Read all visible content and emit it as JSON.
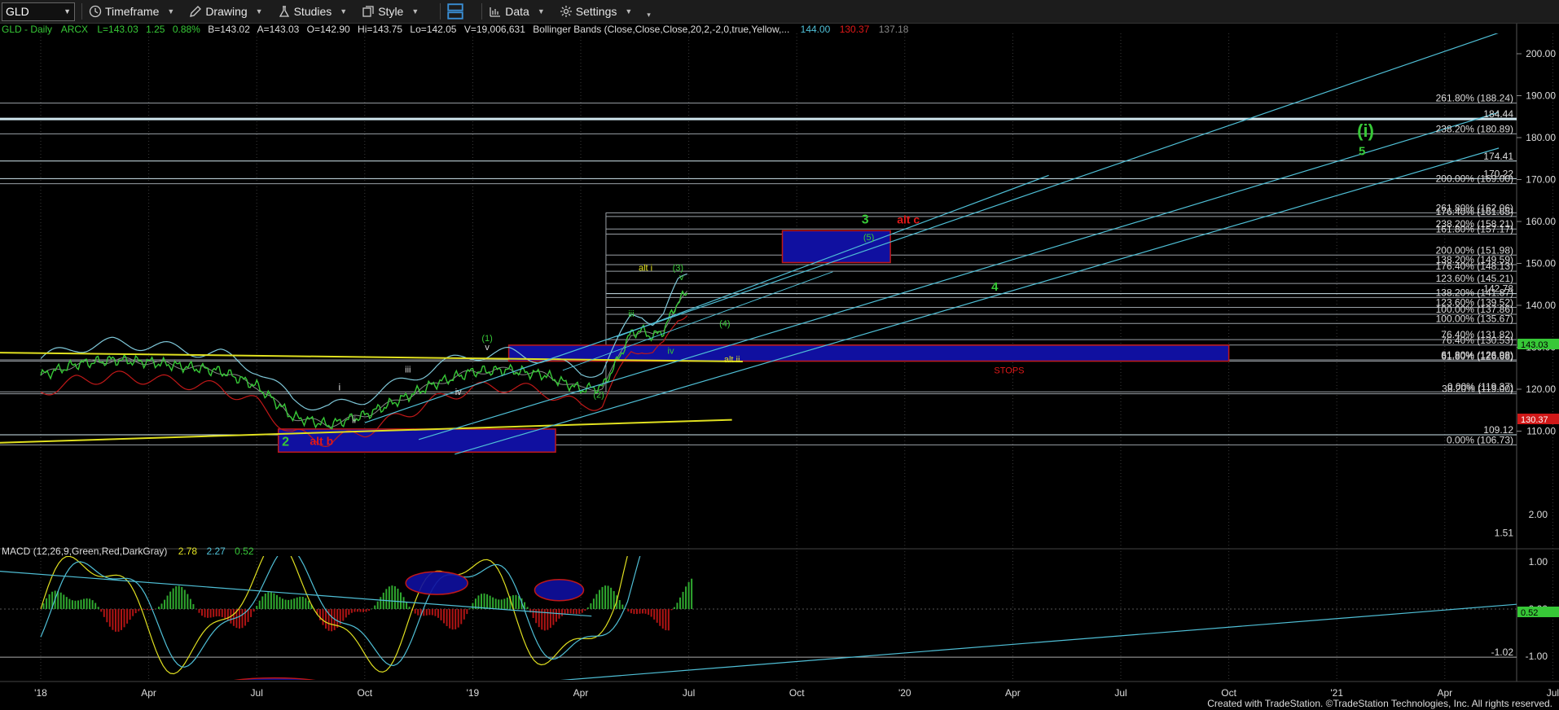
{
  "toolbar": {
    "symbol": "GLD",
    "buttons": [
      {
        "label": "Timeframe",
        "icon": "clock-icon"
      },
      {
        "label": "Drawing",
        "icon": "pencil-icon"
      },
      {
        "label": "Studies",
        "icon": "flask-icon"
      },
      {
        "label": "Style",
        "icon": "style-icon"
      },
      {
        "label": "Data",
        "icon": "bar-chart-icon"
      },
      {
        "label": "Settings",
        "icon": "gear-icon"
      }
    ]
  },
  "header": {
    "symbol": "GLD - Daily",
    "exchange": "ARCX",
    "last": "L=143.03",
    "change": "1.25",
    "pct": "0.88%",
    "bid": "B=143.02",
    "ask": "A=143.03",
    "open": "O=142.90",
    "high": "Hi=143.75",
    "low": "Lo=142.05",
    "volume": "V=19,006,631",
    "study": "Bollinger Bands (Close,Close,Close,20,2,-2,0,true,Yellow,...",
    "bb_upper": "144.00",
    "bb_lower": "130.37",
    "bb_mid": "137.18"
  },
  "macd_header": {
    "study": "MACD (12,26,9,Green,Red,DarkGray)",
    "v1": "2.78",
    "v2": "2.27",
    "v3": "0.52"
  },
  "price_axis": [
    "200.00",
    "190.00",
    "180.00",
    "170.00",
    "160.00",
    "150.00",
    "140.00",
    "130.00",
    "120.00",
    "110.00"
  ],
  "price_tags": {
    "last": "143.03",
    "lower_band": "130.37"
  },
  "macd_axis": [
    "2.00",
    "1.00",
    "0.00",
    "-1.00"
  ],
  "macd_tag": "0.52",
  "macd_levels": [
    "1.51",
    "-1.02"
  ],
  "time_axis": [
    "'18",
    "Apr",
    "Jul",
    "Oct",
    "'19",
    "Apr",
    "Jul",
    "Oct",
    "'20",
    "Apr",
    "Jul",
    "Oct",
    "'21",
    "Apr",
    "Jul"
  ],
  "fib_labels": [
    {
      "text": "261.80% (188.24)",
      "p": 188.24
    },
    {
      "text": "184.44",
      "p": 184.44
    },
    {
      "text": "238.20% (180.89)",
      "p": 180.89
    },
    {
      "text": "174.41",
      "p": 174.41
    },
    {
      "text": "170.22",
      "p": 170.22
    },
    {
      "text": "200.00% (169.00)",
      "p": 169.0
    },
    {
      "text": "261.80% (162.06)",
      "p": 162.06
    },
    {
      "text": "176.40% (161.65)",
      "p": 161.2
    },
    {
      "text": "238.20% (158.21)",
      "p": 158.21
    },
    {
      "text": "161.80% (157.17)",
      "p": 157.0
    },
    {
      "text": "200.00% (151.98)",
      "p": 151.98
    },
    {
      "text": "138.20% (149.59)",
      "p": 149.7
    },
    {
      "text": "176.40% (148.13)",
      "p": 148.13
    },
    {
      "text": "123.60% (145.21)",
      "p": 145.21
    },
    {
      "text": "142.78",
      "p": 142.78
    },
    {
      "text": "138.20% (141.87)",
      "p": 141.87
    },
    {
      "text": "123.60% (139.52)",
      "p": 139.52
    },
    {
      "text": "100.00% (137.86)",
      "p": 137.86
    },
    {
      "text": "100.00% (135.67)",
      "p": 135.67
    },
    {
      "text": "76.40% (131.82)",
      "p": 131.82
    },
    {
      "text": "76.40% (130.53)",
      "p": 130.53
    },
    {
      "text": "61.80% (126.98)",
      "p": 126.98
    },
    {
      "text": "61.80% (126.68)",
      "p": 126.68
    },
    {
      "text": "0.00% (119.37)",
      "p": 119.37
    },
    {
      "text": "38.20% (119.00)",
      "p": 118.9
    },
    {
      "text": "109.12",
      "p": 109.12
    },
    {
      "text": "0.00% (106.73)",
      "p": 106.73
    }
  ],
  "wave_labels": [
    {
      "text": "(i)",
      "t": 36.8,
      "p": 180.2,
      "color": "#37c837",
      "size": 22
    },
    {
      "text": "5",
      "t": 36.7,
      "p": 175.8,
      "color": "#37c837",
      "size": 15
    },
    {
      "text": "3",
      "t": 22.9,
      "p": 159.5,
      "color": "#37c837",
      "size": 16
    },
    {
      "text": "alt c",
      "t": 24.1,
      "p": 159.5,
      "color": "#e01818",
      "size": 14
    },
    {
      "text": "(5)",
      "t": 23.0,
      "p": 155.5,
      "color": "#37c837",
      "size": 11
    },
    {
      "text": "4",
      "t": 26.5,
      "p": 143.5,
      "color": "#37c837",
      "size": 15
    },
    {
      "text": "alt i",
      "t": 16.8,
      "p": 148.3,
      "color": "#e0e020",
      "size": 11
    },
    {
      "text": "(3)",
      "t": 17.7,
      "p": 148.3,
      "color": "#37c837",
      "size": 11
    },
    {
      "text": "v",
      "t": 17.8,
      "p": 146.0,
      "color": "#37c837",
      "size": 11
    },
    {
      "text": "iii",
      "t": 16.4,
      "p": 137.3,
      "color": "#37c837",
      "size": 11
    },
    {
      "text": "(4)",
      "t": 19.0,
      "p": 135.0,
      "color": "#37c837",
      "size": 11
    },
    {
      "text": "iv",
      "t": 17.5,
      "p": 128.4,
      "color": "#37c837",
      "size": 11
    },
    {
      "text": "alt ii",
      "t": 19.2,
      "p": 126.4,
      "color": "#e0e020",
      "size": 11
    },
    {
      "text": "STOPS",
      "t": 26.9,
      "p": 123.8,
      "color": "#e01818",
      "size": 11
    },
    {
      "text": "(2)",
      "t": 15.5,
      "p": 118.0,
      "color": "#37c837",
      "size": 11
    },
    {
      "text": "(1)",
      "t": 12.4,
      "p": 131.5,
      "color": "#37c837",
      "size": 11
    },
    {
      "text": "v",
      "t": 12.4,
      "p": 129.3,
      "color": "#ddd",
      "size": 11
    },
    {
      "text": "iii",
      "t": 10.2,
      "p": 124.0,
      "color": "#ddd",
      "size": 11
    },
    {
      "text": "iv",
      "t": 11.6,
      "p": 118.6,
      "color": "#ddd",
      "size": 11
    },
    {
      "text": "i",
      "t": 8.3,
      "p": 119.7,
      "color": "#ddd",
      "size": 12
    },
    {
      "text": "ii",
      "t": 8.7,
      "p": 111.9,
      "color": "#ddd",
      "size": 11
    },
    {
      "text": "2",
      "t": 6.8,
      "p": 106.5,
      "color": "#37c837",
      "size": 16
    },
    {
      "text": "alt b",
      "t": 7.8,
      "p": 106.7,
      "color": "#e01818",
      "size": 14
    }
  ],
  "footer": "Created with TradeStation. ©TradeStation Technologies, Inc. All rights reserved.",
  "colors": {
    "background": "#000000",
    "grid": "#3a3a3a",
    "bollinger_upper": "#7ec7d8",
    "bollinger_lower": "#c01818",
    "bollinger_mid": "#e0e020",
    "price": "#37c837",
    "channel": "#4fbfd6",
    "trendline": "#e0e020",
    "box": "#1010a0",
    "box_border": "#c01818"
  }
}
